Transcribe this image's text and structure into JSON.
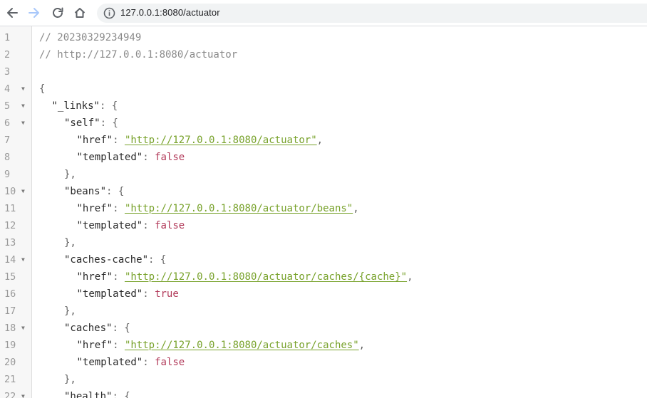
{
  "browser": {
    "url": "127.0.0.1:8080/actuator"
  },
  "viewer": {
    "lines": [
      {
        "n": "1",
        "fold": false,
        "indent": 0,
        "parts": [
          {
            "c": "cm",
            "t": "// 20230329234949"
          }
        ]
      },
      {
        "n": "2",
        "fold": false,
        "indent": 0,
        "parts": [
          {
            "c": "cm",
            "t": "// http://127.0.0.1:8080/actuator"
          }
        ]
      },
      {
        "n": "3",
        "fold": false,
        "indent": 0,
        "parts": []
      },
      {
        "n": "4",
        "fold": true,
        "indent": 0,
        "parts": [
          {
            "c": "punc",
            "t": "{"
          }
        ]
      },
      {
        "n": "5",
        "fold": true,
        "indent": 1,
        "parts": [
          {
            "c": "key",
            "t": "\"_links\""
          },
          {
            "c": "punc",
            "t": ": {"
          }
        ]
      },
      {
        "n": "6",
        "fold": true,
        "indent": 2,
        "parts": [
          {
            "c": "key",
            "t": "\"self\""
          },
          {
            "c": "punc",
            "t": ": {"
          }
        ]
      },
      {
        "n": "7",
        "fold": false,
        "indent": 3,
        "parts": [
          {
            "c": "key",
            "t": "\"href\""
          },
          {
            "c": "punc",
            "t": ": "
          },
          {
            "c": "str",
            "t": "\"http://127.0.0.1:8080/actuator\""
          },
          {
            "c": "punc",
            "t": ","
          }
        ]
      },
      {
        "n": "8",
        "fold": false,
        "indent": 3,
        "parts": [
          {
            "c": "key",
            "t": "\"templated\""
          },
          {
            "c": "punc",
            "t": ": "
          },
          {
            "c": "bool",
            "t": "false"
          }
        ]
      },
      {
        "n": "9",
        "fold": false,
        "indent": 2,
        "parts": [
          {
            "c": "punc",
            "t": "},"
          }
        ]
      },
      {
        "n": "10",
        "fold": true,
        "indent": 2,
        "parts": [
          {
            "c": "key",
            "t": "\"beans\""
          },
          {
            "c": "punc",
            "t": ": {"
          }
        ]
      },
      {
        "n": "11",
        "fold": false,
        "indent": 3,
        "parts": [
          {
            "c": "key",
            "t": "\"href\""
          },
          {
            "c": "punc",
            "t": ": "
          },
          {
            "c": "str",
            "t": "\"http://127.0.0.1:8080/actuator/beans\""
          },
          {
            "c": "punc",
            "t": ","
          }
        ]
      },
      {
        "n": "12",
        "fold": false,
        "indent": 3,
        "parts": [
          {
            "c": "key",
            "t": "\"templated\""
          },
          {
            "c": "punc",
            "t": ": "
          },
          {
            "c": "bool",
            "t": "false"
          }
        ]
      },
      {
        "n": "13",
        "fold": false,
        "indent": 2,
        "parts": [
          {
            "c": "punc",
            "t": "},"
          }
        ]
      },
      {
        "n": "14",
        "fold": true,
        "indent": 2,
        "parts": [
          {
            "c": "key",
            "t": "\"caches-cache\""
          },
          {
            "c": "punc",
            "t": ": {"
          }
        ]
      },
      {
        "n": "15",
        "fold": false,
        "indent": 3,
        "parts": [
          {
            "c": "key",
            "t": "\"href\""
          },
          {
            "c": "punc",
            "t": ": "
          },
          {
            "c": "str",
            "t": "\"http://127.0.0.1:8080/actuator/caches/{cache}\""
          },
          {
            "c": "punc",
            "t": ","
          }
        ]
      },
      {
        "n": "16",
        "fold": false,
        "indent": 3,
        "parts": [
          {
            "c": "key",
            "t": "\"templated\""
          },
          {
            "c": "punc",
            "t": ": "
          },
          {
            "c": "bool",
            "t": "true"
          }
        ]
      },
      {
        "n": "17",
        "fold": false,
        "indent": 2,
        "parts": [
          {
            "c": "punc",
            "t": "},"
          }
        ]
      },
      {
        "n": "18",
        "fold": true,
        "indent": 2,
        "parts": [
          {
            "c": "key",
            "t": "\"caches\""
          },
          {
            "c": "punc",
            "t": ": {"
          }
        ]
      },
      {
        "n": "19",
        "fold": false,
        "indent": 3,
        "parts": [
          {
            "c": "key",
            "t": "\"href\""
          },
          {
            "c": "punc",
            "t": ": "
          },
          {
            "c": "str",
            "t": "\"http://127.0.0.1:8080/actuator/caches\""
          },
          {
            "c": "punc",
            "t": ","
          }
        ]
      },
      {
        "n": "20",
        "fold": false,
        "indent": 3,
        "parts": [
          {
            "c": "key",
            "t": "\"templated\""
          },
          {
            "c": "punc",
            "t": ": "
          },
          {
            "c": "bool",
            "t": "false"
          }
        ]
      },
      {
        "n": "21",
        "fold": false,
        "indent": 2,
        "parts": [
          {
            "c": "punc",
            "t": "},"
          }
        ]
      },
      {
        "n": "22",
        "fold": true,
        "indent": 2,
        "parts": [
          {
            "c": "key",
            "t": "\"health\""
          },
          {
            "c": "punc",
            "t": ": {"
          }
        ]
      }
    ]
  },
  "icons": {
    "back": "arrow-left-icon",
    "forward": "arrow-right-icon",
    "reload": "reload-icon",
    "home": "home-icon",
    "site_info": "info-icon",
    "fold": "triangle-down-icon"
  },
  "colors": {
    "string_link": "#78a22b",
    "boolean": "#b23a5a",
    "comment": "#8a8a8a"
  }
}
